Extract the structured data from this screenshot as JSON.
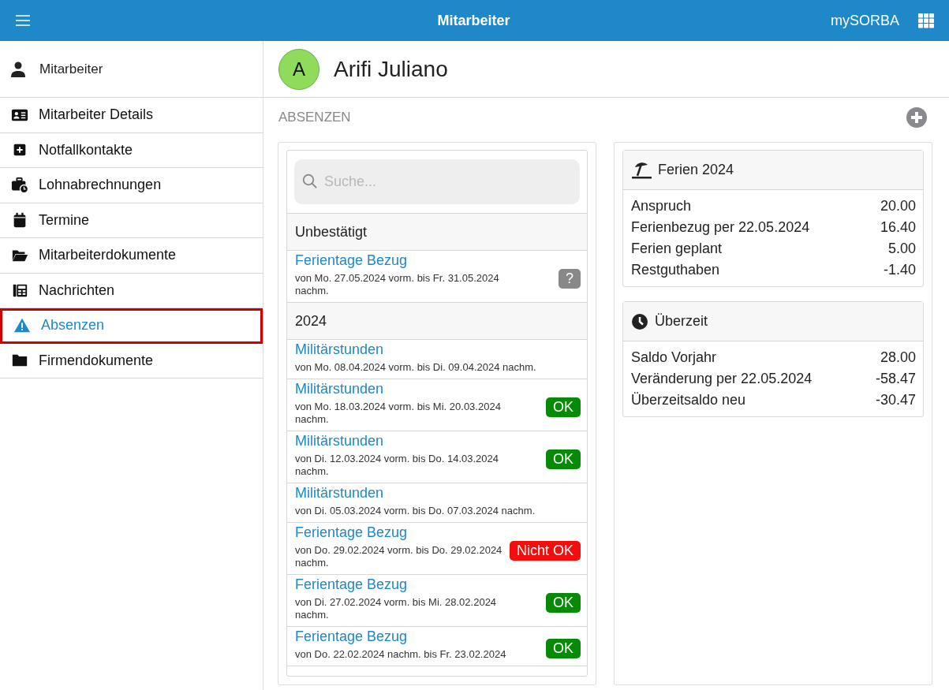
{
  "topbar": {
    "title": "Mitarbeiter",
    "brand": "mySORBA"
  },
  "sidebar": {
    "header": "Mitarbeiter",
    "items": [
      {
        "label": "Mitarbeiter Details",
        "selected": false
      },
      {
        "label": "Notfallkontakte",
        "selected": false
      },
      {
        "label": "Lohnabrechnungen",
        "selected": false
      },
      {
        "label": "Termine",
        "selected": false
      },
      {
        "label": "Mitarbeiterdokumente",
        "selected": false
      },
      {
        "label": "Nachrichten",
        "selected": false
      },
      {
        "label": "Absenzen",
        "selected": true
      },
      {
        "label": "Firmendokumente",
        "selected": false
      }
    ]
  },
  "profile": {
    "initial": "A",
    "name": "Arifi Juliano"
  },
  "section": {
    "title": "ABSENZEN"
  },
  "search": {
    "placeholder": "Suche..."
  },
  "groups": [
    {
      "title": "Unbestätigt",
      "items": [
        {
          "title": "Ferientage Bezug",
          "period": "von Mo. 27.05.2024 vorm. bis Fr. 31.05.2024 nachm.",
          "status": {
            "kind": "pending",
            "label": "?"
          }
        }
      ]
    },
    {
      "title": "2024",
      "items": [
        {
          "title": "Militärstunden",
          "period": "von Mo. 08.04.2024 vorm. bis Di. 09.04.2024 nachm."
        },
        {
          "title": "Militärstunden",
          "period": "von Mo. 18.03.2024 vorm. bis Mi. 20.03.2024 nachm.",
          "status": {
            "kind": "ok",
            "label": "OK"
          }
        },
        {
          "title": "Militärstunden",
          "period": "von Di. 12.03.2024 vorm. bis Do. 14.03.2024 nachm.",
          "status": {
            "kind": "ok",
            "label": "OK"
          }
        },
        {
          "title": "Militärstunden",
          "period": "von Di. 05.03.2024 vorm. bis Do. 07.03.2024 nachm."
        },
        {
          "title": "Ferientage Bezug",
          "period": "von Do. 29.02.2024 vorm. bis Do. 29.02.2024 nachm.",
          "status": {
            "kind": "rejected",
            "label": "Nicht OK"
          }
        },
        {
          "title": "Ferientage Bezug",
          "period": "von Di. 27.02.2024 vorm. bis Mi. 28.02.2024 nachm.",
          "status": {
            "kind": "ok",
            "label": "OK"
          }
        },
        {
          "title": "Ferientage Bezug",
          "period": "von Do. 22.02.2024 nachm. bis Fr. 23.02.2024",
          "status": {
            "kind": "ok",
            "label": "OK"
          }
        }
      ]
    }
  ],
  "summaries": [
    {
      "title": "Ferien 2024",
      "rows": [
        {
          "label": "Anspruch",
          "value": "20.00"
        },
        {
          "label": "Ferienbezug per 22.05.2024",
          "value": "16.40"
        },
        {
          "label": "Ferien geplant",
          "value": "5.00"
        },
        {
          "label": "Restguthaben",
          "value": "-1.40"
        }
      ]
    },
    {
      "title": "Überzeit",
      "rows": [
        {
          "label": "Saldo Vorjahr",
          "value": "28.00"
        },
        {
          "label": "Veränderung per 22.05.2024",
          "value": "-58.47"
        },
        {
          "label": "Überzeitsaldo neu",
          "value": "-30.47"
        }
      ]
    }
  ]
}
